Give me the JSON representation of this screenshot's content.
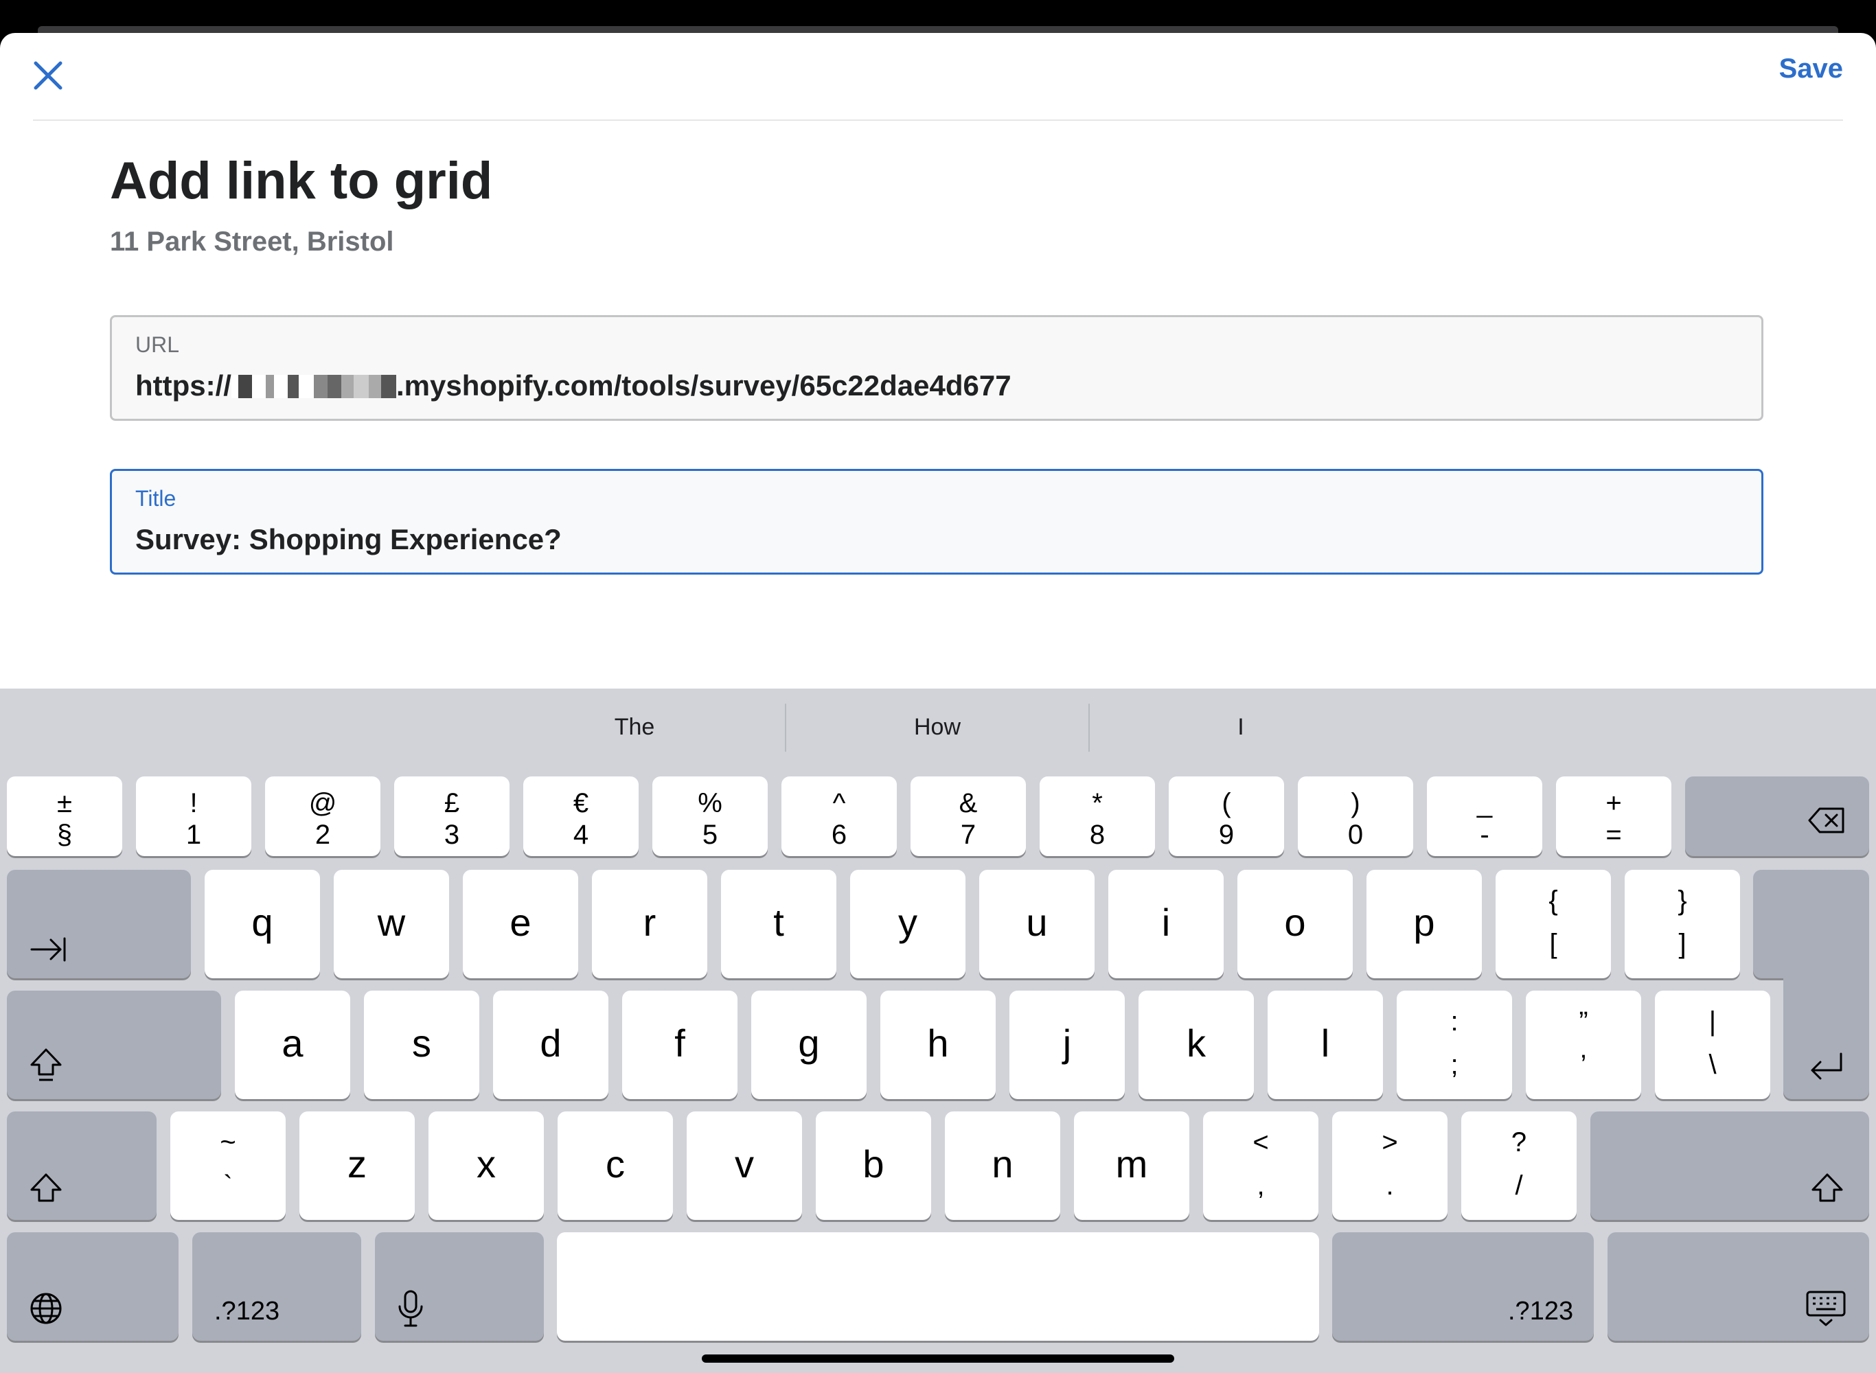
{
  "header": {
    "save_label": "Save"
  },
  "page": {
    "title": "Add link to grid",
    "subtitle": "11 Park Street, Bristol"
  },
  "url_field": {
    "label": "URL",
    "value_prefix": "https://",
    "value_suffix": ".myshopify.com/tools/survey/65c22dae4d677"
  },
  "title_field": {
    "label": "Title",
    "value": "Survey: Shopping Experience?"
  },
  "keyboard": {
    "suggestions": [
      "The",
      "How",
      "I"
    ],
    "number_row": [
      {
        "top": "±",
        "bottom": "§"
      },
      {
        "top": "!",
        "bottom": "1"
      },
      {
        "top": "@",
        "bottom": "2"
      },
      {
        "top": "£",
        "bottom": "3"
      },
      {
        "top": "€",
        "bottom": "4"
      },
      {
        "top": "%",
        "bottom": "5"
      },
      {
        "top": "^",
        "bottom": "6"
      },
      {
        "top": "&",
        "bottom": "7"
      },
      {
        "top": "*",
        "bottom": "8"
      },
      {
        "top": "(",
        "bottom": "9"
      },
      {
        "top": ")",
        "bottom": "0"
      },
      {
        "top": "_",
        "bottom": "-"
      },
      {
        "top": "+",
        "bottom": "="
      }
    ],
    "row_q": [
      "q",
      "w",
      "e",
      "r",
      "t",
      "y",
      "u",
      "i",
      "o",
      "p"
    ],
    "row_q_extra": [
      {
        "top": "{",
        "bottom": "["
      },
      {
        "top": "}",
        "bottom": "]"
      }
    ],
    "row_a": [
      "a",
      "s",
      "d",
      "f",
      "g",
      "h",
      "j",
      "k",
      "l"
    ],
    "row_a_extra": [
      {
        "top": ":",
        "bottom": ";"
      },
      {
        "top": "”",
        "bottom": "’"
      },
      {
        "top": "|",
        "bottom": "\\"
      }
    ],
    "row_z_first": {
      "top": "~",
      "bottom": "`"
    },
    "row_z": [
      "z",
      "x",
      "c",
      "v",
      "b",
      "n",
      "m"
    ],
    "row_z_extra": [
      {
        "top": "<",
        "bottom": ","
      },
      {
        "top": ">",
        "bottom": "."
      },
      {
        "top": "?",
        "bottom": "/"
      }
    ],
    "numbers_label": ".?123"
  },
  "icons": [
    "close-icon",
    "backspace-icon",
    "tab-icon",
    "caps-lock-icon",
    "return-icon",
    "shift-icon",
    "globe-icon",
    "microphone-icon",
    "keyboard-dismiss-icon"
  ],
  "colors": {
    "accent": "#2c6ecb",
    "keyboard_bg": "#d1d3d9",
    "dark_key": "#a9aeb9"
  }
}
